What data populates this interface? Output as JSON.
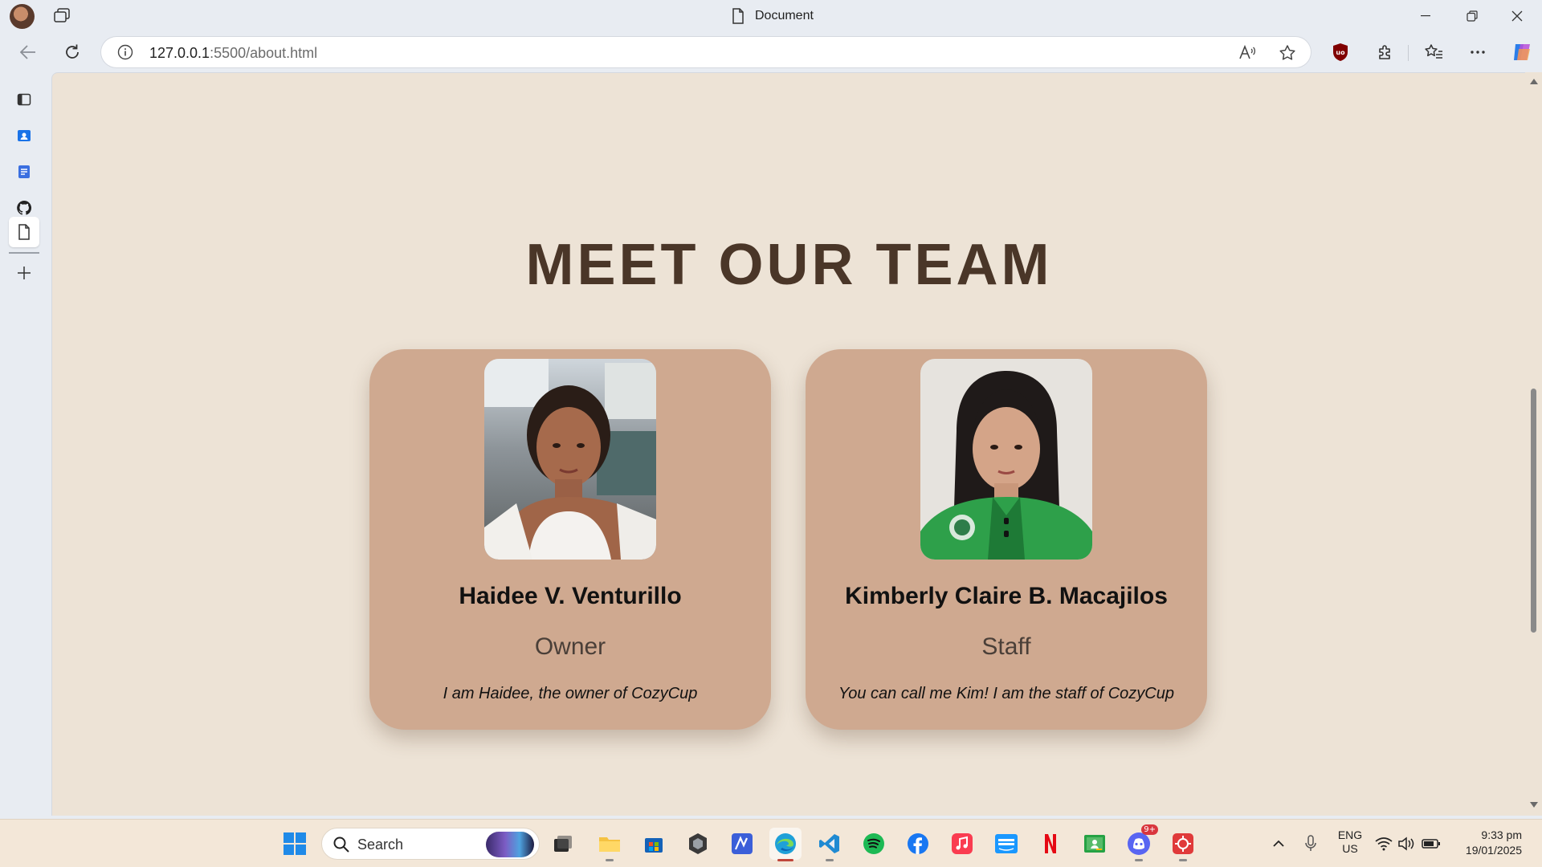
{
  "window": {
    "title": "Document"
  },
  "address_bar": {
    "url_host": "127.0.0.1",
    "url_path": ":5500/about.html"
  },
  "sidebar": {
    "items": [
      "tab-actions-icon",
      "outlook-contacts-icon",
      "docs-icon",
      "github-icon",
      "document-icon",
      "add-icon"
    ]
  },
  "page": {
    "heading": "MEET OUR TEAM",
    "team": [
      {
        "name": "Haidee V. Venturillo",
        "role": "Owner",
        "description": "I am Haidee, the owner of CozyCup"
      },
      {
        "name": "Kimberly Claire B. Macajilos",
        "role": "Staff",
        "description": "You can call me Kim! I am the staff of CozyCup"
      }
    ]
  },
  "taskbar": {
    "search_placeholder": "Search",
    "discord_badge": "9+",
    "language": "ENG",
    "region": "US",
    "time": "9:33 pm",
    "date": "19/01/2025"
  },
  "colors": {
    "page_background": "#ede3d6",
    "heading": "#4a3628",
    "card": "#cfa990"
  }
}
